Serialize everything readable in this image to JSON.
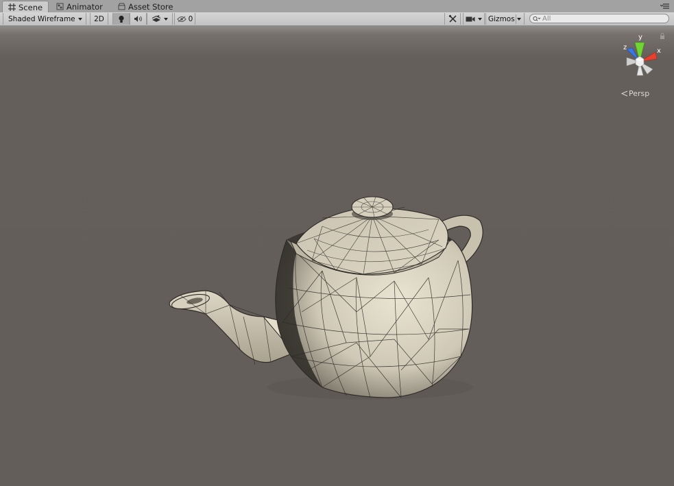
{
  "tabs": [
    {
      "label": "Scene",
      "icon": "grid-icon",
      "active": true
    },
    {
      "label": "Animator",
      "icon": "animator-icon",
      "active": false
    },
    {
      "label": "Asset Store",
      "icon": "store-icon",
      "active": false
    }
  ],
  "toolbar": {
    "draw_mode": "Shaded Wireframe",
    "mode_2d": "2D",
    "hidden_count": "0",
    "gizmos_label": "Gizmos",
    "search_placeholder": "All"
  },
  "gizmo": {
    "x_label": "x",
    "y_label": "y",
    "z_label": "z"
  },
  "projection_label": "Persp",
  "colors": {
    "viewport_bg": "#645e5a",
    "gizmo_x": "#e8402e",
    "gizmo_y": "#6fd434",
    "gizmo_z": "#3a78e8",
    "model_fill": "#d8d2c2"
  }
}
